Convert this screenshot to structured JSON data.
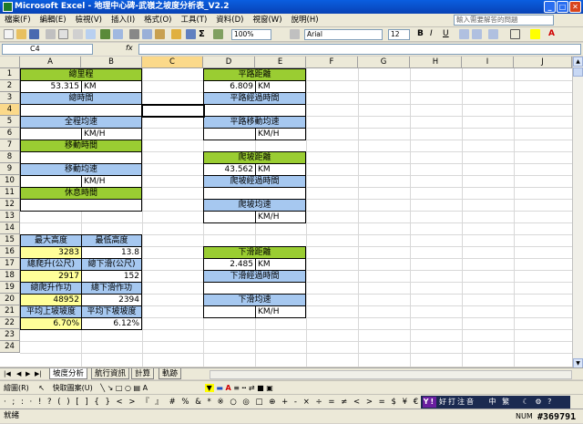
{
  "window": {
    "title": "Microsoft Excel - 地理中心碑-武嶺之坡度分析表_V2.2"
  },
  "menu": [
    "檔案(F)",
    "編輯(E)",
    "檢視(V)",
    "插入(I)",
    "格式(O)",
    "工具(T)",
    "資料(D)",
    "視窗(W)",
    "說明(H)"
  ],
  "help_placeholder": "輸入需要解答的問題",
  "toolbar": {
    "zoom": "100%",
    "font": "Arial",
    "size": "12"
  },
  "formula": {
    "cell": "C4",
    "fx": "fx",
    "value": ""
  },
  "columns": [
    "A",
    "B",
    "C",
    "D",
    "E",
    "F",
    "G",
    "H",
    "I",
    "J"
  ],
  "rows": [
    "1",
    "2",
    "3",
    "4",
    "5",
    "6",
    "7",
    "8",
    "9",
    "10",
    "11",
    "12",
    "13",
    "14",
    "15",
    "16",
    "17",
    "18",
    "19",
    "20",
    "21",
    "22",
    "23",
    "24"
  ],
  "cells": {
    "total_distance_label": "總里程",
    "total_distance_value": "53.315",
    "total_distance_unit": "KM",
    "total_time_label": "總時間",
    "avg_speed_label": "全程均速",
    "avg_speed_unit": "KM/H",
    "moving_time_label": "移動時間",
    "moving_speed_label": "移動均速",
    "moving_speed_unit": "KM/H",
    "rest_time_label": "休息時間",
    "flat_distance_label": "平路距離",
    "flat_distance_value": "6.809",
    "flat_distance_unit": "KM",
    "flat_time_label": "平路經過時間",
    "flat_speed_label": "平路移動均速",
    "flat_speed_unit": "KM/H",
    "climb_distance_label": "爬坡距離",
    "climb_distance_value": "43.562",
    "climb_distance_unit": "KM",
    "climb_time_label": "爬坡經過時間",
    "climb_speed_label": "爬坡均速",
    "climb_speed_unit": "KM/H",
    "descent_distance_label": "下滑距離",
    "descent_distance_value": "2.485",
    "descent_distance_unit": "KM",
    "descent_time_label": "下滑經過時間",
    "descent_speed_label": "下滑均速",
    "descent_speed_unit": "KM/H",
    "max_height_label": "最大高度",
    "max_height_value": "3283",
    "min_height_label": "最低高度",
    "min_height_value": "13.8",
    "total_climb_label": "總爬升(公尺)",
    "total_climb_value": "2917",
    "total_descent_label": "總下滑(公尺)",
    "total_descent_value": "152",
    "climb_work_label": "總爬升作功",
    "climb_work_value": "48952",
    "descent_work_label": "總下滑作功",
    "descent_work_value": "2394",
    "avg_up_grade_label": "平均上坡坡度",
    "avg_up_grade_value": "6.70%",
    "avg_down_grade_label": "平均下坡坡度",
    "avg_down_grade_value": "6.12%"
  },
  "sheet_tabs": [
    "坡度分析",
    "航行資訊",
    "計算",
    "軌跡"
  ],
  "draw_toolbar": {
    "draw": "繪圖(R)",
    "autoshape": "快取圖案(U)"
  },
  "symbols": "‧ ; : ‧ ! ? ( ) [ ] { } < > 『 』 # % & * ※ ○ ◎ □ ⊕ + - × ÷ = ≠ < > = $ ¥ € ℃ ℉",
  "ime": {
    "label": "好打注音",
    "text": "中 繁"
  },
  "status": {
    "ready": "就緒",
    "num": "NUM",
    "watermark": "#369791"
  }
}
